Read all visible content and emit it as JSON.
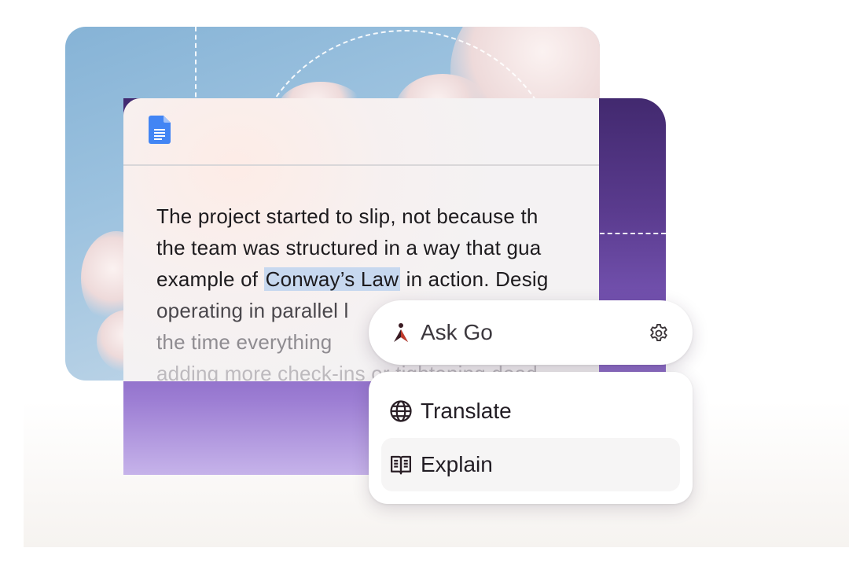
{
  "document": {
    "lines": {
      "l1": "The project started to slip, not because th",
      "l2": "the team was structured in a way that gua",
      "l3_before": "example of ",
      "l3_highlight": "Conway’s Law",
      "l3_after": " in action. Desig",
      "l4": "operating in parallel l",
      "l5": "the time everything",
      "l6": "adding more check-ins or tightening dead"
    },
    "highlight_color": "#c7d8ef"
  },
  "ask_bar": {
    "placeholder": "Ask Go",
    "icon_left": "go-logo-icon",
    "icon_right": "gear-icon"
  },
  "menu": {
    "items": [
      {
        "label": "Translate",
        "icon": "globe-icon"
      },
      {
        "label": "Explain",
        "icon": "book-icon"
      }
    ]
  },
  "colors": {
    "purple_dark": "#42296f",
    "purple_light": "#c6b3ea",
    "sky": "#9cc2df",
    "docs_blue": "#4285f4"
  }
}
